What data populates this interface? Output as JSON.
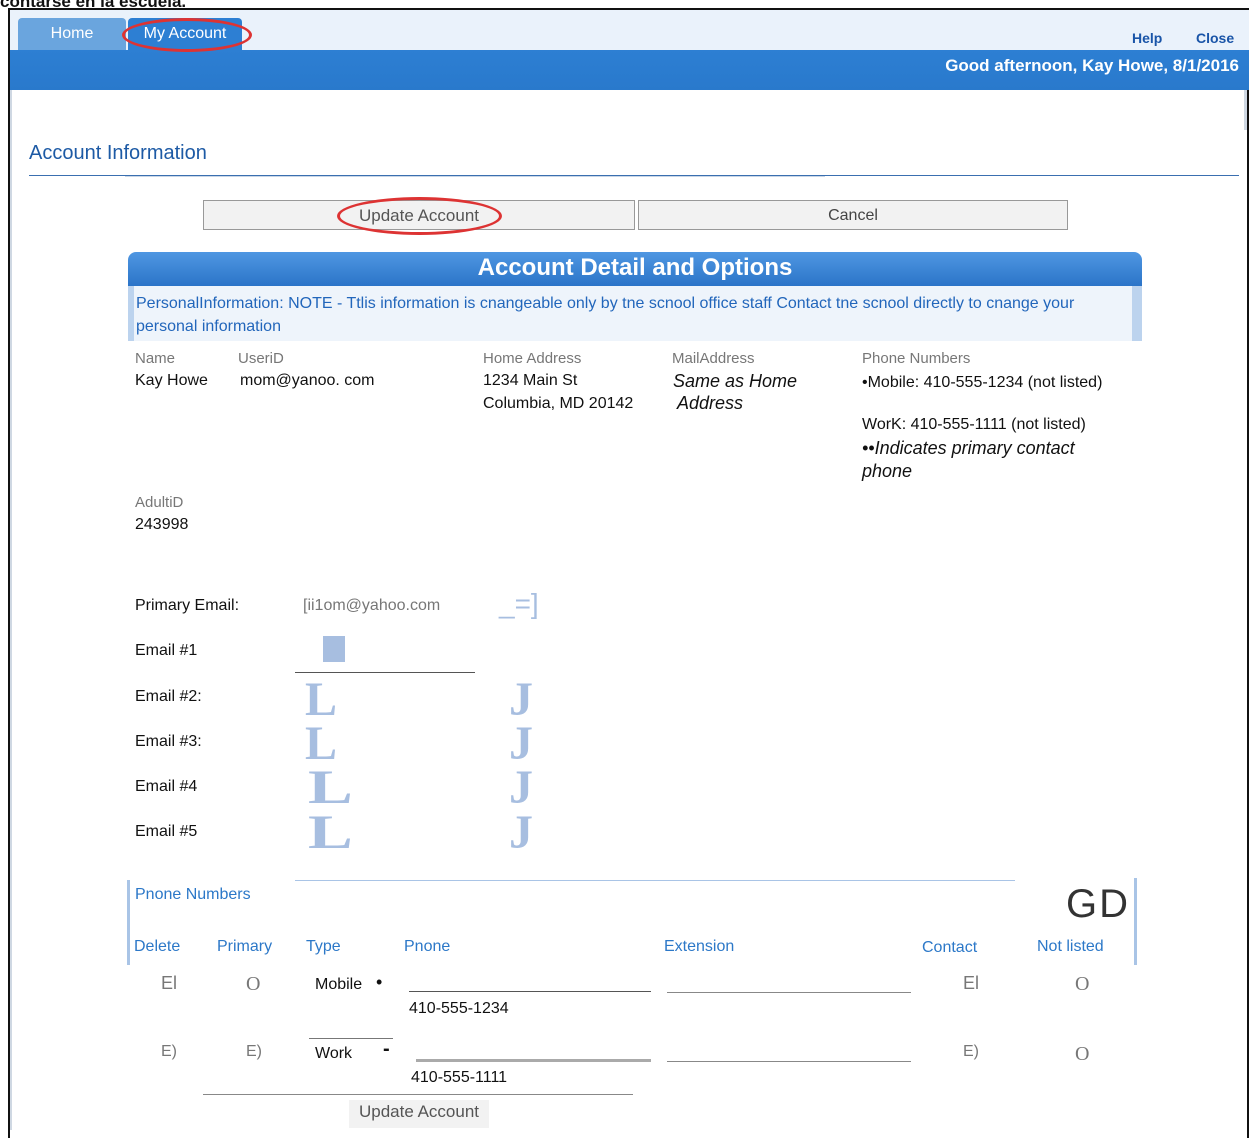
{
  "page_heading_cut": "contarse en la escuela.",
  "nav": {
    "tabs": [
      {
        "label": "Home"
      },
      {
        "label": "My Account"
      }
    ],
    "links": {
      "help": "Help",
      "close": "Close"
    },
    "greeting": "Good afternoon, Kay Howe, 8/1/2016"
  },
  "account": {
    "title": "Account Information",
    "update_label": "Update Account",
    "cancel_label": "Cancel"
  },
  "panel": {
    "title": "Account Detail and Options",
    "note": "PersonalInformation: NOTE - Ttlis information is cnangeable only by tne scnool office staff Contact tne scnool directly to cnange your personal information"
  },
  "personal": {
    "name_label": "Name",
    "name": "Kay Howe",
    "userid_label": "UseriD",
    "userid": "mom@yanoo. com",
    "home_label": "Home Address",
    "home_line1": "1234 Main St",
    "home_line2": "Columbia, MD 20142",
    "mail_label": "MailAddress",
    "mail_line1": "Same as Home",
    "mail_line2": "Address",
    "phones_label": "Phone Numbers",
    "phone_mobile": "•Mobile: 410-555-1234 (not listed)",
    "phone_work": "WorK: 410-555-1111 (not listed)",
    "phone_note": "••Indicates primary contact phone",
    "adult_label": "AdultiD",
    "adult_id": "243998"
  },
  "emails": {
    "primary_label": "Primary Email:",
    "primary_value": "[ii1om@yahoo.com",
    "primary_end": "_=]",
    "email1": "Email #1",
    "email2": "Email #2:",
    "email3": "Email #3:",
    "email4": "Email #4",
    "email5": "Email #5",
    "bracket_left": "L",
    "bracket_right": "J"
  },
  "phones": {
    "section_label": "Pnone Numbers",
    "gd": "GD",
    "columns": [
      "Delete",
      "Primary",
      "Type",
      "Pnone",
      "Extension",
      "Contact",
      "Not listed"
    ],
    "rows": [
      {
        "delete": "El",
        "primary": "O",
        "type": "Mobile",
        "marker": "•",
        "number": "410-555-1234",
        "contact": "El",
        "not_listed": "O"
      },
      {
        "delete": "E)",
        "primary": "E)",
        "type": "Work",
        "marker": "-",
        "number": "410-555-1111",
        "contact": "E)",
        "not_listed": "O"
      }
    ]
  },
  "bottom": {
    "update_label": "Update Account"
  }
}
